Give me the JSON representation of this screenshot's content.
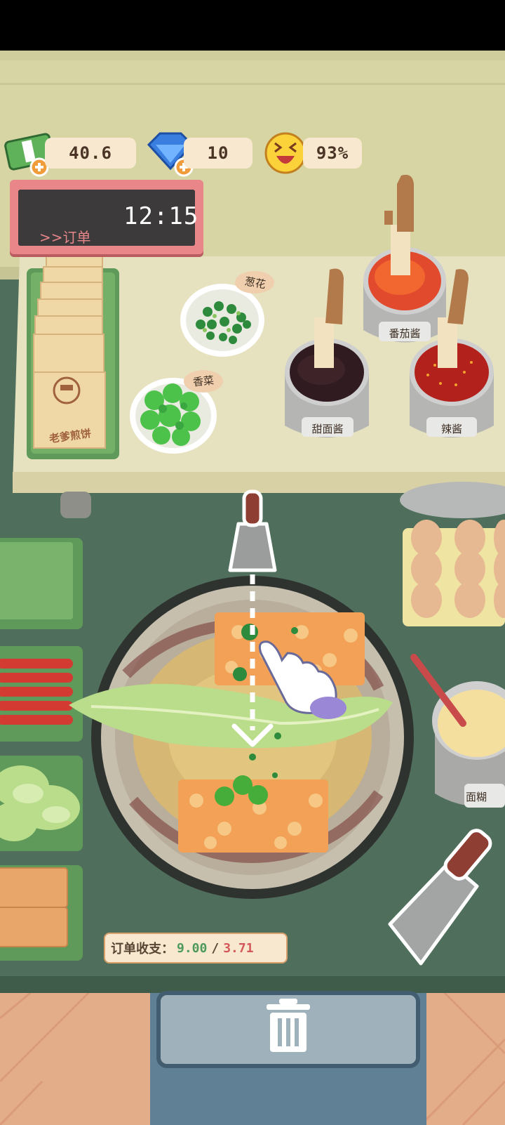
{
  "hud": {
    "cash_value": "40.6",
    "gems_value": "10",
    "satisfaction_value": "93%",
    "cash_icon": "cash-stack-icon",
    "gem_icon": "diamond-icon",
    "satisfaction_icon": "laughing-face-icon",
    "add_icon": "plus-icon"
  },
  "order_board": {
    "link_label": ">>订单",
    "time": "12:15",
    "list_icon": "list-icon",
    "alert_icon": "alert-icon"
  },
  "ingredients": {
    "wrapper_box_label": "老爹煎饼",
    "scallion_label": "葱花",
    "cilantro_label": "香菜",
    "tomato_sauce_label": "番茄酱",
    "sweet_sauce_label": "甜面酱",
    "chili_sauce_label": "辣酱",
    "batter_label": "面糊"
  },
  "footer": {
    "income_label": "订单收支：",
    "income_revenue": "9.00",
    "income_separator": "/",
    "income_cost": "3.71"
  },
  "colors": {
    "table_green": "#4f6e5b",
    "counter_cream": "#e6e1bf",
    "wall": "#d7d5a4",
    "pill_bg": "#f7e8cf",
    "revenue_green": "#4d9a5c",
    "cost_red": "#d4585a"
  }
}
